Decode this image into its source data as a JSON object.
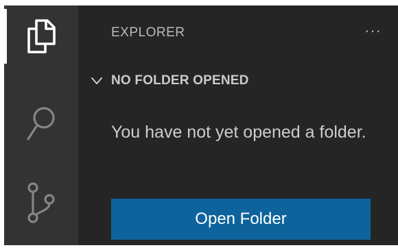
{
  "activity_bar": {
    "items": [
      {
        "icon": "files-icon",
        "active": true
      },
      {
        "icon": "search-icon",
        "active": false
      },
      {
        "icon": "source-control-icon",
        "active": false
      }
    ]
  },
  "sidebar": {
    "title": "EXPLORER",
    "more_actions_label": "···",
    "section": {
      "title": "NO FOLDER OPENED",
      "expanded": true,
      "message": "You have not yet opened a folder.",
      "button_label": "Open Folder"
    }
  },
  "colors": {
    "activity_bar_bg": "#333333",
    "sidebar_bg": "#252526",
    "button_bg": "#0e639c",
    "text": "#cccccc"
  }
}
